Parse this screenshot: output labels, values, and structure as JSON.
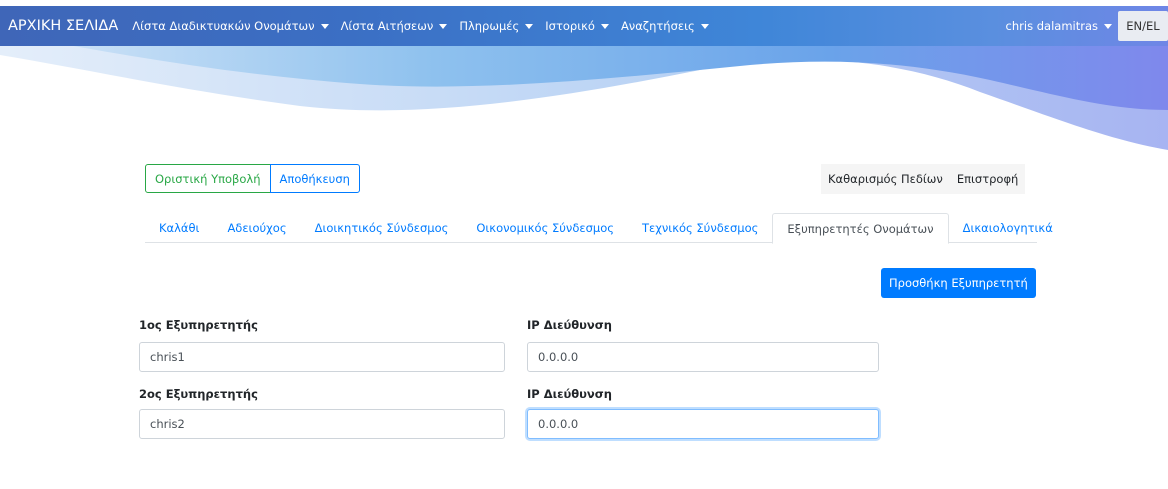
{
  "navbar": {
    "brand": "ΑΡΧΙΚΗ ΣΕΛΙΔΑ",
    "items": [
      {
        "label": "Λίστα Διαδικτυακών Ονομάτων"
      },
      {
        "label": "Λίστα Αιτήσεων"
      },
      {
        "label": "Πληρωμές"
      },
      {
        "label": "Ιστορικό"
      },
      {
        "label": "Αναζητήσεις"
      }
    ],
    "user": "chris dalamitras",
    "language": "EN/EL"
  },
  "actions": {
    "final_submit": "Οριστική Υποβολή",
    "save": "Αποθήκευση",
    "clear_fields": "Καθαρισμός Πεδίων",
    "back": "Επιστροφή"
  },
  "tabs": [
    {
      "label": "Καλάθι",
      "active": false
    },
    {
      "label": "Αδειούχος",
      "active": false
    },
    {
      "label": "Διοικητικός Σύνδεσμος",
      "active": false
    },
    {
      "label": "Οικονομικός Σύνδεσμος",
      "active": false
    },
    {
      "label": "Τεχνικός Σύνδεσμος",
      "active": false
    },
    {
      "label": "Εξυπηρετητές Ονομάτων",
      "active": true
    },
    {
      "label": "Δικαιολογητικά",
      "active": false
    }
  ],
  "add_server_button": "Προσθήκη Εξυπηρετητή",
  "servers": [
    {
      "name_label": "1ος Εξυπηρετητής",
      "name_value": "chris1",
      "ip_label": "IP Διεύθυνση",
      "ip_value": "0.0.0.0"
    },
    {
      "name_label": "2ος Εξυπηρετητής",
      "name_value": "chris2",
      "ip_label": "IP Διεύθυνση",
      "ip_value": "0.0.0.0"
    }
  ],
  "colors": {
    "primary": "#007bff",
    "success": "#28a745",
    "navbar_start": "#3f66b8",
    "navbar_end": "#6f86e6"
  }
}
